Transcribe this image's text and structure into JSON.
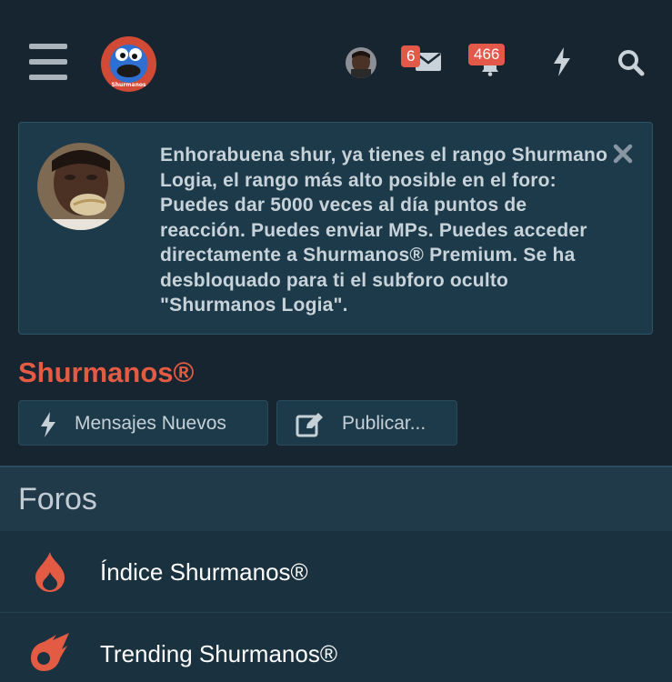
{
  "header": {
    "menu_icon": "hamburger-icon",
    "logo_icon": "cookie-monster-logo",
    "logo_text": "Shurmanos",
    "user_avatar": "user-avatar",
    "messages": {
      "icon": "envelope-icon",
      "count": "6"
    },
    "alerts": {
      "icon": "bell-icon",
      "count": "466"
    },
    "new_icon": "lightning-icon",
    "search_icon": "search-icon"
  },
  "notice": {
    "text": "Enhorabuena shur, ya tienes el rango Shurmano Logia, el rango más alto posible en el foro: Puedes dar 5000 veces al día puntos de reacción. Puedes enviar MPs. Puedes acceder directamente a Shurmanos® Premium. Se ha desbloquado para ti el subforo oculto \"Shurmanos Logia\".",
    "close_icon": "close-icon"
  },
  "site": {
    "title": "Shurmanos®"
  },
  "actions": {
    "new_posts": "Mensajes Nuevos",
    "post": "Publicar..."
  },
  "forums": {
    "heading": "Foros",
    "items": [
      {
        "label": "Índice Shurmanos®",
        "icon": "flame-icon"
      },
      {
        "label": "Trending Shurmanos®",
        "icon": "meteor-icon"
      }
    ]
  },
  "colors": {
    "background": "#172530",
    "panel": "#1d3a4b",
    "accent": "#e45b44",
    "badge": "#e2594a"
  }
}
